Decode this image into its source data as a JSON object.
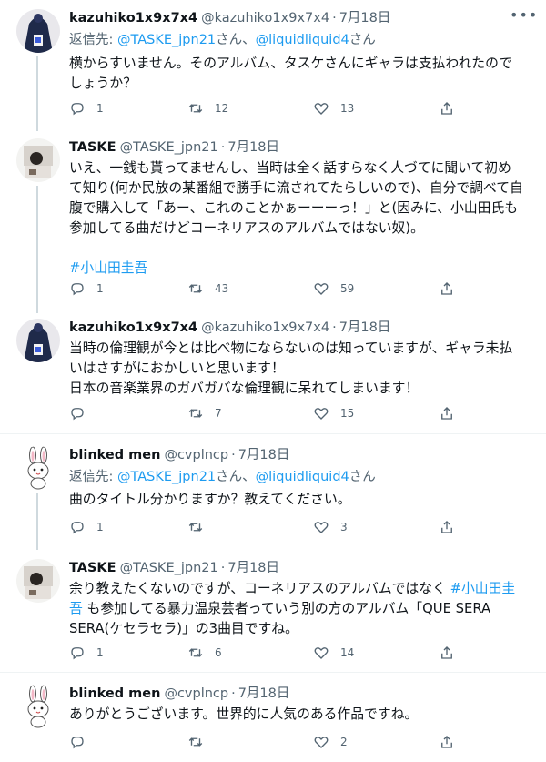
{
  "tweets": [
    {
      "name": "kazuhiko1x9x7x4",
      "handle": "@kazuhiko1x9x7x4",
      "date": "7月18日",
      "reply_prefix": "返信先: ",
      "reply_mention_1": "@TASKE_jpn21",
      "reply_mid": "さん、",
      "reply_mention_2": "@liquidliquid4",
      "reply_suffix": "さん",
      "lines": [
        "横からすいません。そのアルバム、タスケさんにギャラは支払われたので",
        "しょうか？"
      ],
      "replies": "1",
      "retweets": "12",
      "likes": "13"
    },
    {
      "name": "TASKE",
      "handle": "@TASKE_jpn21",
      "date": "7月18日",
      "lines": [
        "いえ、一銭も貰ってませんし、当時は全く話すらなく人づてに聞いて初め",
        "て知り(何か民放の某番組で勝手に流されてたらしいので)、自分で調べて自",
        "腹で購入して「あー、これのことかぁーーーっ！」と(因みに、小山田氏も",
        "参加してる曲だけどコーネリアスのアルバムではない奴)。"
      ],
      "hashtag": "#小山田圭吾",
      "replies": "1",
      "retweets": "43",
      "likes": "59"
    },
    {
      "name": "kazuhiko1x9x7x4",
      "handle": "@kazuhiko1x9x7x4",
      "date": "7月18日",
      "lines": [
        "当時の倫理観が今とは比べ物にならないのは知っていますが、ギャラ未払",
        "いはさすがにおかしいと思います！",
        "日本の音楽業界のガバガバな倫理観に呆れてしまいます！"
      ],
      "replies": "",
      "retweets": "7",
      "likes": "15"
    },
    {
      "name": "blinked men",
      "handle": "@cvplncp",
      "date": "7月18日",
      "reply_prefix": "返信先: ",
      "reply_mention_1": "@TASKE_jpn21",
      "reply_mid": "さん、",
      "reply_mention_2": "@liquidliquid4",
      "reply_suffix": "さん",
      "lines": [
        "曲のタイトル分かりますか？教えてください。"
      ],
      "replies": "1",
      "retweets": "",
      "likes": "3"
    },
    {
      "name": "TASKE",
      "handle": "@TASKE_jpn21",
      "date": "7月18日",
      "line1_a": "余り教えたくないのですが、コーネリアスのアルバムではなく ",
      "line1_tag": "#小山田圭",
      "line2_tag": "吾",
      "line2_b": " も参加してる暴力温泉芸者っていう別の方のアルバム「QUE SERA",
      "line3": "SERA(ケセラセラ)」の3曲目ですね。",
      "replies": "1",
      "retweets": "6",
      "likes": "14"
    },
    {
      "name": "blinked men",
      "handle": "@cvplncp",
      "date": "7月18日",
      "lines": [
        "ありがとうございます。世界的に人気のある作品ですね。"
      ],
      "replies": "",
      "retweets": "",
      "likes": "2"
    }
  ],
  "icons": {
    "reply": "reply-icon",
    "retweet": "retweet-icon",
    "like": "like-icon",
    "share": "share-icon",
    "more": "more-icon"
  },
  "colors": {
    "link": "#1d9bf0",
    "secondary": "#536471",
    "divider": "#eff3f4",
    "thread": "#cfd9de"
  }
}
